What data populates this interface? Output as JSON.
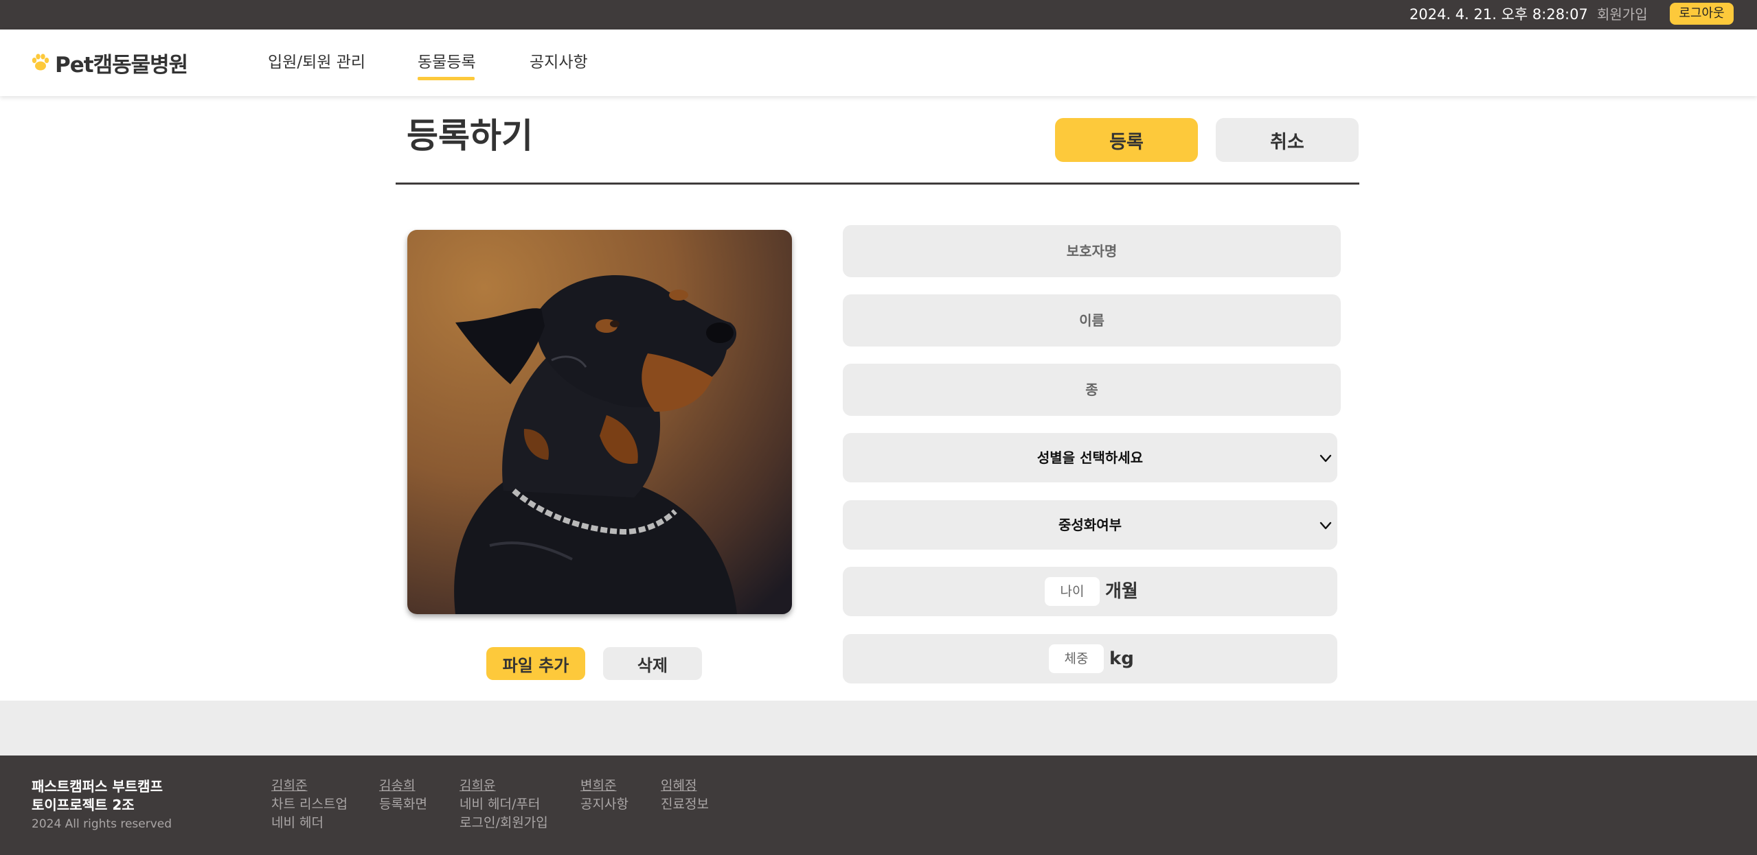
{
  "topbar": {
    "datetime": "2024. 4. 21. 오후 8:28:07",
    "signup_label": "회원가입",
    "logout_label": "로그아웃"
  },
  "header": {
    "logo_text": "Pet캠동물병원",
    "nav": [
      {
        "label": "입원/퇴원 관리",
        "active": false
      },
      {
        "label": "동물등록",
        "active": true
      },
      {
        "label": "공지사항",
        "active": false
      }
    ]
  },
  "main": {
    "title": "등록하기",
    "register_label": "등록",
    "cancel_label": "취소",
    "photo_subject": "rottweiler-photo",
    "file_add_label": "파일 추가",
    "delete_label": "삭제",
    "form": {
      "guardian_placeholder": "보호자명",
      "name_placeholder": "이름",
      "species_placeholder": "종",
      "gender_selected": "성별을 선택하세요",
      "neuter_selected": "중성화여부",
      "age_placeholder": "나이",
      "age_unit": "개월",
      "weight_placeholder": "체중",
      "weight_unit": "kg"
    }
  },
  "footer": {
    "brand_line1": "패스트캠퍼스 부트캠프",
    "brand_line2": "토이프로젝트 2조",
    "copyright": "2024 All rights reserved",
    "members": [
      {
        "name": "김희준",
        "tasks": [
          "차트 리스트업",
          "네비 헤더"
        ]
      },
      {
        "name": "김송희",
        "tasks": [
          "등록화면"
        ]
      },
      {
        "name": "김희윤",
        "tasks": [
          "네비 헤더/푸터",
          "로그인/회원가입"
        ]
      },
      {
        "name": "변희준",
        "tasks": [
          "공지사항"
        ]
      },
      {
        "name": "임혜정",
        "tasks": [
          "진료정보"
        ]
      }
    ]
  },
  "colors": {
    "accent_yellow": "#fdc93b",
    "dark_bar": "#3f3b3b",
    "field_gray": "#ececec",
    "icons": [
      "paw-icon",
      "chevron-down-icon"
    ]
  }
}
